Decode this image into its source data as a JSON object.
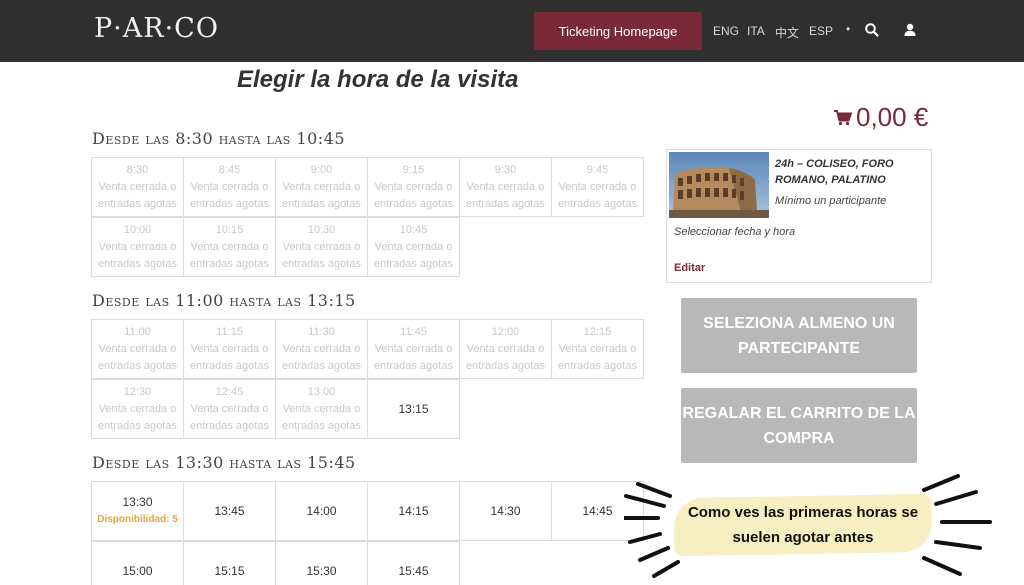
{
  "header": {
    "logo": "P·AR·CO",
    "ticketing_button": "Ticketing Homepage",
    "languages": [
      "ENG",
      "ITA",
      "中文",
      "ESP"
    ],
    "separator": "•",
    "icons": [
      "search-icon",
      "user-icon"
    ],
    "colors": {
      "bar": "#2f2f2f",
      "accent": "#7a2a37"
    }
  },
  "page": {
    "title": "Elegir la hora de la visita"
  },
  "sections": [
    {
      "title": "Desde las 8:30 hasta las 10:45",
      "slots": [
        {
          "time": "8:30",
          "status": "Venta cerrada o entradas agotas"
        },
        {
          "time": "8:45",
          "status": "Venta cerrada o entradas agotas"
        },
        {
          "time": "9:00",
          "status": "Venta cerrada o entradas agotas"
        },
        {
          "time": "9:15",
          "status": "Venta cerrada o entradas agotas"
        },
        {
          "time": "9:30",
          "status": "Venta cerrada o entradas agotas"
        },
        {
          "time": "9:45",
          "status": "Venta cerrada o entradas agotas"
        },
        {
          "time": "10:00",
          "status": "Venta cerrada o entradas agotas"
        },
        {
          "time": "10:15",
          "status": "Venta cerrada o entradas agotas"
        },
        {
          "time": "10:30",
          "status": "Venta cerrada o entradas agotas"
        },
        {
          "time": "10:45",
          "status": "Venta cerrada o entradas agotas"
        }
      ]
    },
    {
      "title": "Desde las 11:00 hasta las 13:15",
      "slots": [
        {
          "time": "11:00",
          "status": "Venta cerrada o entradas agotas"
        },
        {
          "time": "11:15",
          "status": "Venta cerrada o entradas agotas"
        },
        {
          "time": "11:30",
          "status": "Venta cerrada o entradas agotas"
        },
        {
          "time": "11:45",
          "status": "Venta cerrada o entradas agotas"
        },
        {
          "time": "12:00",
          "status": "Venta cerrada o entradas agotas"
        },
        {
          "time": "12:15",
          "status": "Venta cerrada o entradas agotas"
        },
        {
          "time": "12:30",
          "status": "Venta cerrada o entradas agotas"
        },
        {
          "time": "12:45",
          "status": "Venta cerrada o entradas agotas"
        },
        {
          "time": "13:00",
          "status": "Venta cerrada o entradas agotas"
        },
        {
          "time": "13:15",
          "status": ""
        }
      ]
    },
    {
      "title": "Desde las 13:30 hasta las 15:45",
      "slots": [
        {
          "time": "13:30",
          "status": "",
          "availability": "Disponibilidad: 5"
        },
        {
          "time": "13:45",
          "status": ""
        },
        {
          "time": "14:00",
          "status": ""
        },
        {
          "time": "14:15",
          "status": ""
        },
        {
          "time": "14:30",
          "status": ""
        },
        {
          "time": "14:45",
          "status": ""
        },
        {
          "time": "15:00",
          "status": ""
        },
        {
          "time": "15:15",
          "status": ""
        },
        {
          "time": "15:30",
          "status": ""
        },
        {
          "time": "15:45",
          "status": ""
        }
      ]
    }
  ],
  "cart": {
    "total": "0,00 €",
    "product_title": "24h – COLISEO, FORO ROMANO, PALATINO",
    "minimum": "Mínimo un participante",
    "date_hint": "Seleccionar fecha y hora",
    "edit_label": "Editar",
    "select_participant_button": "SELEZIONA ALMENO UN PARTECIPANTE",
    "gift_button": "REGALAR EL CARRITO DE LA COMPRA"
  },
  "annotation": {
    "text": "Como ves las primeras horas se suelen agotar antes"
  }
}
